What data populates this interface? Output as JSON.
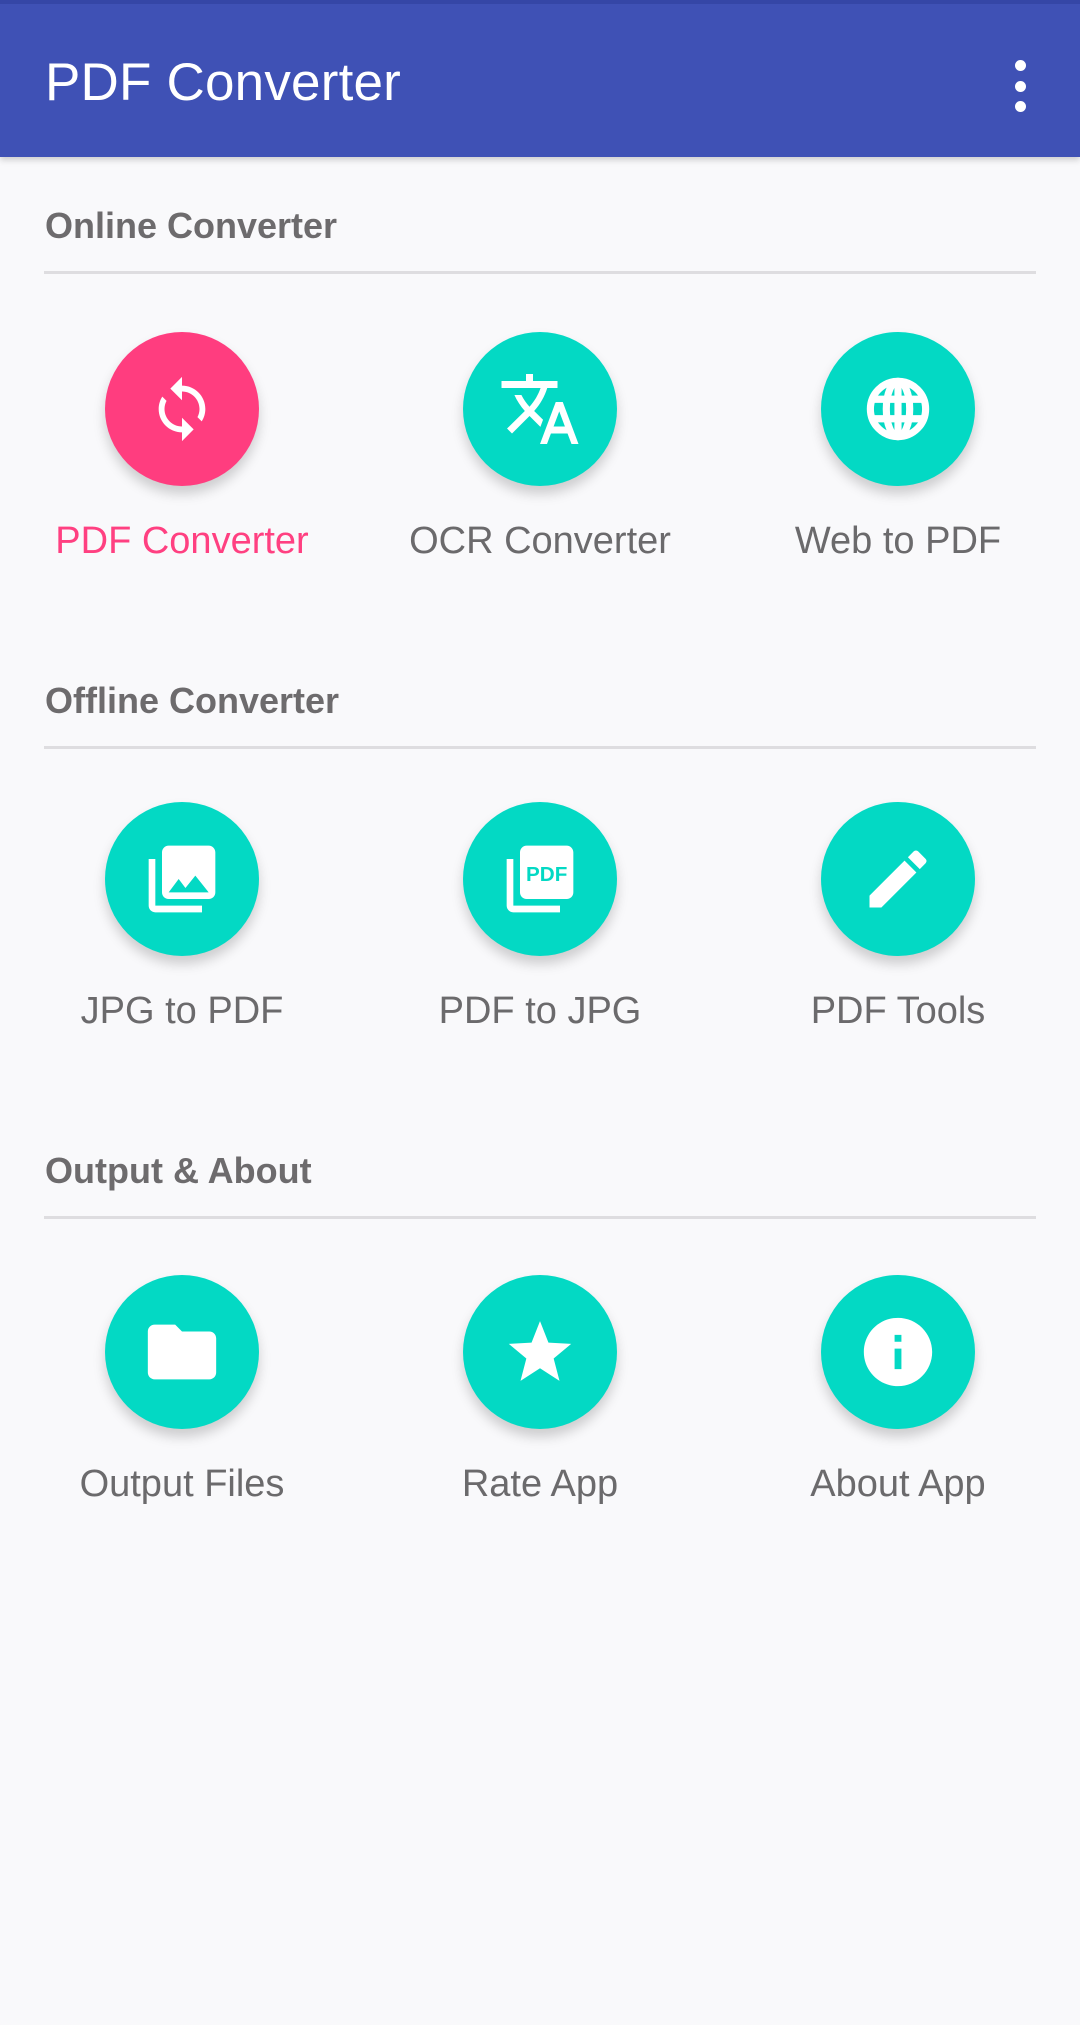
{
  "app_bar": {
    "title": "PDF Converter",
    "menu_icon": "more-vert-icon",
    "background_color": "#3f51b5"
  },
  "colors": {
    "accent": "#03d9c4",
    "selected": "#ff4081",
    "section_text": "#6d6b6d",
    "label_text": "#6b6a6c"
  },
  "sections": [
    {
      "title": "Online Converter",
      "items": [
        {
          "label": "PDF Converter",
          "icon": "sync-icon",
          "selected": true
        },
        {
          "label": "OCR Converter",
          "icon": "translate-icon",
          "selected": false
        },
        {
          "label": "Web to PDF",
          "icon": "globe-icon",
          "selected": false
        }
      ]
    },
    {
      "title": "Offline Converter",
      "items": [
        {
          "label": "JPG to PDF",
          "icon": "photo-library-icon",
          "selected": false
        },
        {
          "label": "PDF to JPG",
          "icon": "pdf-library-icon",
          "selected": false
        },
        {
          "label": "PDF Tools",
          "icon": "pencil-icon",
          "selected": false
        }
      ]
    },
    {
      "title": "Output & About",
      "items": [
        {
          "label": "Output Files",
          "icon": "folder-icon",
          "selected": false
        },
        {
          "label": "Rate App",
          "icon": "star-icon",
          "selected": false
        },
        {
          "label": "About App",
          "icon": "info-icon",
          "selected": false
        }
      ]
    }
  ]
}
